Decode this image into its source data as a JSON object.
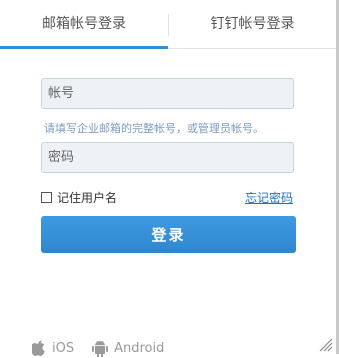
{
  "tabs": {
    "email_login": "邮箱帐号登录",
    "dingtalk_login": "钉钉帐号登录"
  },
  "form": {
    "account_placeholder": "帐号",
    "account_value": "",
    "hint": "请填写企业邮箱的完整帐号，或管理员帐号。",
    "password_placeholder": "密码",
    "password_value": "",
    "remember_label": "记住用户名",
    "remember_checked": false,
    "forgot_label": "忘记密码",
    "submit_label": "登录"
  },
  "apps": {
    "ios_label": "iOS",
    "android_label": "Android"
  },
  "colors": {
    "accent": "#2e8fdb",
    "hint": "#7b9cc3",
    "link": "#1e6fc8"
  }
}
